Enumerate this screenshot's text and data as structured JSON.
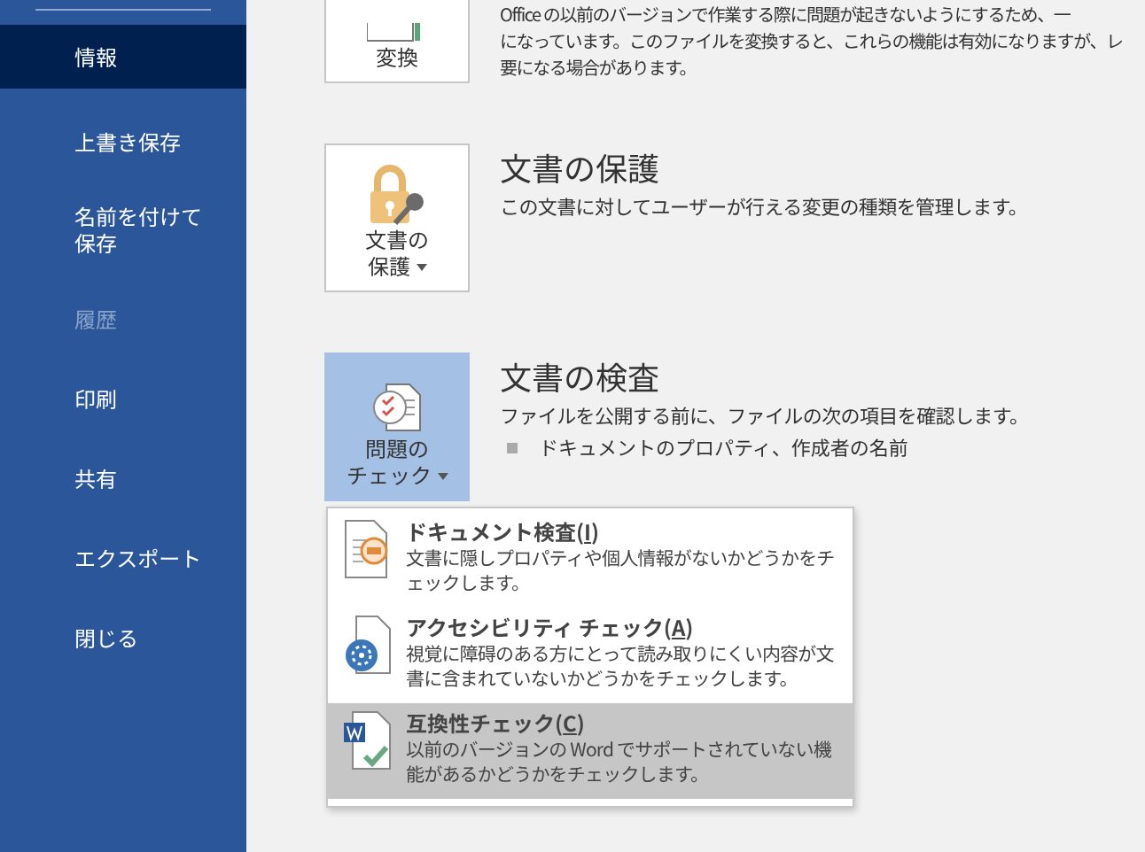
{
  "sidebar": {
    "items": [
      {
        "label": "情報",
        "selected": true,
        "disabled": false
      },
      {
        "label": "上書き保存",
        "selected": false,
        "disabled": false
      },
      {
        "label": "名前を付けて保存",
        "selected": false,
        "disabled": false
      },
      {
        "label": "履歴",
        "selected": false,
        "disabled": true
      },
      {
        "label": "印刷",
        "selected": false,
        "disabled": false
      },
      {
        "label": "共有",
        "selected": false,
        "disabled": false
      },
      {
        "label": "エクスポート",
        "selected": false,
        "disabled": false
      },
      {
        "label": "閉じる",
        "selected": false,
        "disabled": false
      }
    ]
  },
  "sections": [
    {
      "kind": "convert",
      "button": {
        "label_lines": [
          "変換"
        ],
        "has_menu": false,
        "highlighted": false
      },
      "description_lines": [
        "Office の以前のバージョンで作業する際に問題が起きないようにするため、一",
        "になっています。このファイルを変換すると、これらの機能は有効になりますが、レ",
        "要になる場合があります。"
      ]
    },
    {
      "kind": "protect",
      "button": {
        "label_lines": [
          "文書の",
          "保護"
        ],
        "has_menu": true,
        "highlighted": false
      },
      "title": "文書の保護",
      "description_lines": [
        "この文書に対してユーザーが行える変更の種類を管理します。"
      ]
    },
    {
      "kind": "inspect",
      "button": {
        "label_lines": [
          "問題の",
          "チェック"
        ],
        "has_menu": true,
        "highlighted": true
      },
      "title": "文書の検査",
      "description_lines": [
        "ファイルを公開する前に、ファイルの次の項目を確認します。"
      ],
      "bullets": [
        "ドキュメントのプロパティ、作成者の名前"
      ]
    }
  ],
  "menu": {
    "items": [
      {
        "kind": "inspect",
        "title": "ドキュメント検査(",
        "access_key": "I",
        "title_end": ")",
        "description": "文書に隠しプロパティや個人情報がないかどうかをチェックします。",
        "selected": false
      },
      {
        "kind": "accessibility",
        "title": "アクセシビリティ チェック(",
        "access_key": "A",
        "title_end": ")",
        "description": "視覚に障碍のある方にとって読み取りにくい内容が文書に含まれていないかどうかをチェックします。",
        "selected": false
      },
      {
        "kind": "compat",
        "title": "互換性チェック(",
        "access_key": "C",
        "title_end": ")",
        "description": "以前のバージョンの Word でサポートされていない機能があるかどうかをチェックします。",
        "selected": true
      }
    ]
  }
}
